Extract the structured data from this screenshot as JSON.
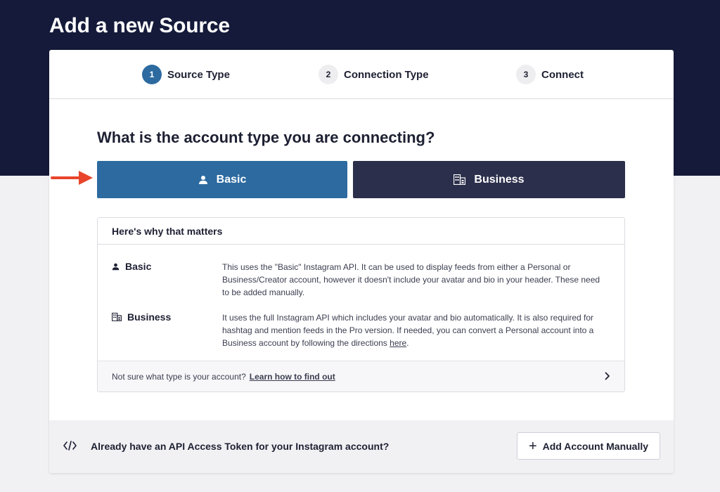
{
  "page": {
    "title": "Add a new Source"
  },
  "steps": [
    {
      "num": "1",
      "label": "Source Type",
      "active": true
    },
    {
      "num": "2",
      "label": "Connection Type",
      "active": false
    },
    {
      "num": "3",
      "label": "Connect",
      "active": false
    }
  ],
  "question": "What is the account type you are connecting?",
  "types": {
    "basic_label": "Basic",
    "business_label": "Business"
  },
  "info": {
    "heading": "Here's why that matters",
    "basic": {
      "name": "Basic",
      "desc": "This uses the \"Basic\" Instagram API. It can be used to display feeds from either a Personal or Business/Creator account, however it doesn't include your avatar and bio in your header. These need to be added manually."
    },
    "business": {
      "name": "Business",
      "desc": "It uses the full Instagram API which includes your avatar and bio automatically. It is also required for hashtag and mention feeds in the Pro version. If needed, you can convert a Personal account into a Business account by following the directions",
      "link": "here",
      "suffix": "."
    },
    "footer_text": "Not sure what type is your account?",
    "footer_link": "Learn how to find out"
  },
  "bottom": {
    "token_text": "Already have an API Access Token for your Instagram account?",
    "button_label": "Add Account Manually"
  },
  "colors": {
    "header_bg": "#151a3a",
    "primary": "#2c6aa0",
    "dark_button": "#2b2f4b",
    "arrow": "#e8452c"
  }
}
